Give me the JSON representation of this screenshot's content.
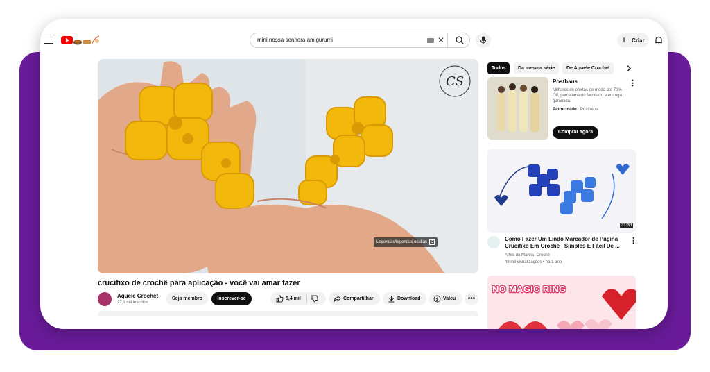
{
  "header": {
    "search_value": "mini nossa senhora amigurumi",
    "create_label": "Criar"
  },
  "video": {
    "captions_badge": "Legendas/legendas ocultas",
    "captions_badge_key": "C",
    "title": "crucifixo de crochê para aplicação - você vai amar fazer",
    "channel_name": "Aquele Crochet",
    "channel_subs": "27,1 mil inscritos",
    "join_label": "Seja membro",
    "subscribe_label": "Inscrever-se",
    "likes": "5,4 mil",
    "share_label": "Compartilhar",
    "download_label": "Download",
    "thanks_label": "Valeu"
  },
  "filter_chips": [
    "Todos",
    "Da mesma série",
    "De Aquele Crochet"
  ],
  "ad": {
    "advertiser": "Posthaus",
    "text": "Milhares de ofertas de moda até 70% Off, parcelamento facilitado e entrega garantida.",
    "sponsored_label": "Patrocinado",
    "sponsor_name": "Posthaus",
    "cta_label": "Comprar agora"
  },
  "recommendations": [
    {
      "title": "Como Fazer Um Lindo Marcador de Página Crucifixo Em Crochê | Simples E Fácil De ...",
      "channel": "Artes da Márcia- Crochê",
      "meta": "48 mil visualizações • há 1 ano",
      "duration": "31:30"
    },
    {
      "thumb_text": "NO MAGIC RING"
    }
  ],
  "colors": {
    "brand_red": "#ff0000",
    "background_purple": "#6a1b9a",
    "yarn_yellow": "#f2b80c",
    "yarn_blue": "#2f4fd4"
  }
}
